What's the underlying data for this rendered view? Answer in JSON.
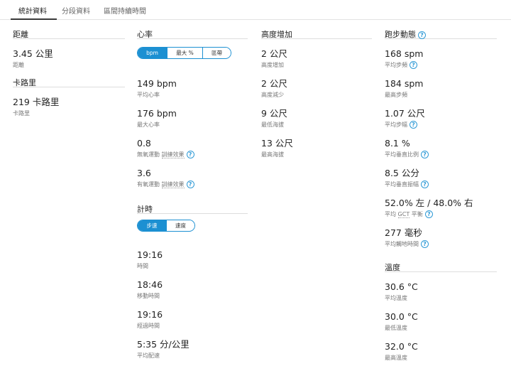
{
  "tabs": [
    "統計資料",
    "分段資料",
    "區間持續時間"
  ],
  "accent_color": "#1c90d2",
  "distance": {
    "title": "距離",
    "value": "3.45 公里",
    "label": "距離"
  },
  "calories": {
    "title": "卡路里",
    "value": "219 卡路里",
    "label": "卡路里"
  },
  "heart_rate": {
    "title": "心率",
    "toggle": [
      "bpm",
      "最大 %",
      "區帶"
    ],
    "stats": [
      {
        "value": "149 bpm",
        "label": "平均心率"
      },
      {
        "value": "176 bpm",
        "label": "最大心率"
      },
      {
        "value": "0.8",
        "label_prefix": "無氧運動",
        "label_link": "訓練效果"
      },
      {
        "value": "3.6",
        "label_prefix": "有氧運動",
        "label_link": "訓練效果"
      }
    ]
  },
  "timing": {
    "title": "計時",
    "toggle": [
      "步速",
      "速度"
    ],
    "stats": [
      {
        "value": "19:16",
        "label": "時間"
      },
      {
        "value": "18:46",
        "label": "移動時間"
      },
      {
        "value": "19:16",
        "label": "經過時間"
      },
      {
        "value": "5:35 分/公里",
        "label": "平均配速"
      }
    ]
  },
  "elevation": {
    "title": "高度增加",
    "stats": [
      {
        "value": "2 公尺",
        "label": "高度增加"
      },
      {
        "value": "2 公尺",
        "label": "高度減少"
      },
      {
        "value": "9 公尺",
        "label": "最低海拔"
      },
      {
        "value": "13 公尺",
        "label": "最高海拔"
      }
    ]
  },
  "running_dynamics": {
    "title": "跑步動態",
    "stats": [
      {
        "value": "168 spm",
        "label": "平均步頻"
      },
      {
        "value": "184 spm",
        "label": "最高步頻"
      },
      {
        "value": "1.07 公尺",
        "label": "平均步幅"
      },
      {
        "value": "8.1 %",
        "label": "平均垂直比例"
      },
      {
        "value": "8.5 公分",
        "label": "平均垂直振幅"
      },
      {
        "value": "52.0% 左 / 48.0% 右",
        "label_prefix": "平均",
        "label_link": "GCT",
        "label_suffix": "平衡"
      },
      {
        "value": "277 毫秒",
        "label": "平均觸地時間"
      }
    ]
  },
  "temperature": {
    "title": "溫度",
    "stats": [
      {
        "value": "30.6 °C",
        "label": "平均溫度"
      },
      {
        "value": "30.0 °C",
        "label": "最低溫度"
      },
      {
        "value": "32.0 °C",
        "label": "最高溫度"
      }
    ]
  }
}
